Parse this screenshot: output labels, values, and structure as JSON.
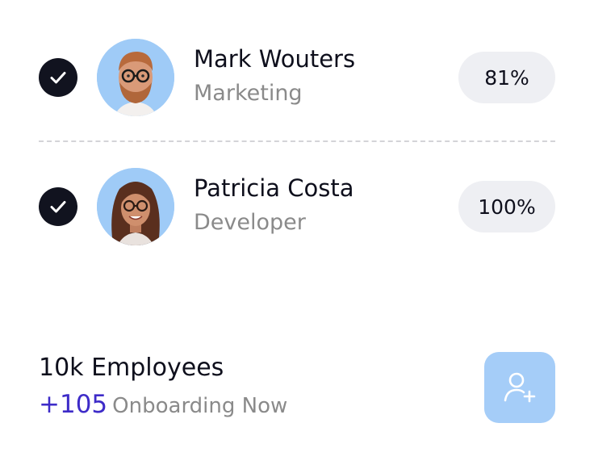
{
  "employees": [
    {
      "name": "Mark Wouters",
      "role": "Marketing",
      "progress": "81%",
      "checked": true,
      "avatar": "avatar-man-glasses-beard"
    },
    {
      "name": "Patricia Costa",
      "role": "Developer",
      "progress": "100%",
      "checked": true,
      "avatar": "avatar-woman-glasses-curly-hair"
    }
  ],
  "summary": {
    "title": "10k Employees",
    "onboarding_count": "+105",
    "onboarding_label": "Onboarding Now"
  },
  "icons": {
    "check": "check-icon",
    "add_user": "add-user-icon"
  },
  "colors": {
    "check_bg": "#11131f",
    "avatar_bg": "#9fcbf7",
    "pill_bg": "#eeeff3",
    "accent": "#3d2bc8",
    "add_button_bg": "#a5cdf8"
  }
}
